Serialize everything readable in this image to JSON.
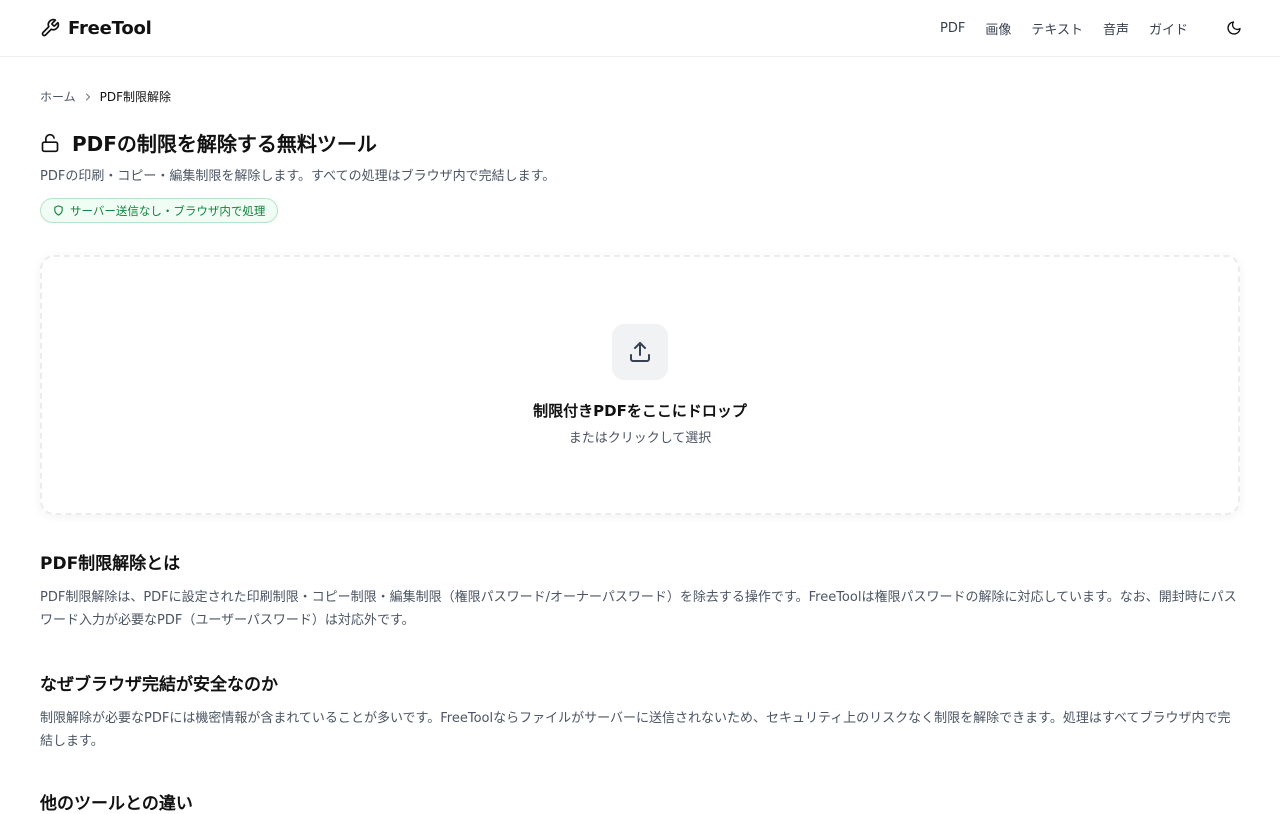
{
  "header": {
    "logo_text": "FreeTool",
    "nav": [
      "PDF",
      "画像",
      "テキスト",
      "音声",
      "ガイド"
    ]
  },
  "breadcrumb": {
    "home": "ホーム",
    "current": "PDF制限解除"
  },
  "page": {
    "title": "PDFの制限を解除する無料ツール",
    "subtitle": "PDFの印刷・コピー・編集制限を解除します。すべての処理はブラウザ内で完結します。",
    "badge": "サーバー送信なし・ブラウザ内で処理"
  },
  "dropzone": {
    "title": "制限付きPDFをここにドロップ",
    "subtitle": "またはクリックして選択"
  },
  "sections": [
    {
      "title": "PDF制限解除とは",
      "body": "PDF制限解除は、PDFに設定された印刷制限・コピー制限・編集制限（権限パスワード/オーナーパスワード）を除去する操作です。FreeToolは権限パスワードの解除に対応しています。なお、開封時にパスワード入力が必要なPDF（ユーザーパスワード）は対応外です。"
    },
    {
      "title": "なぜブラウザ完結が安全なのか",
      "body": "制限解除が必要なPDFには機密情報が含まれていることが多いです。FreeToolならファイルがサーバーに送信されないため、セキュリティ上のリスクなく制限を解除できます。処理はすべてブラウザ内で完結します。"
    },
    {
      "title": "他のツールとの違い"
    }
  ],
  "colors": {
    "badge_green": "#15803d",
    "badge_bg": "#f0fdf4",
    "text_primary": "#111111",
    "text_secondary": "#4b5563"
  }
}
